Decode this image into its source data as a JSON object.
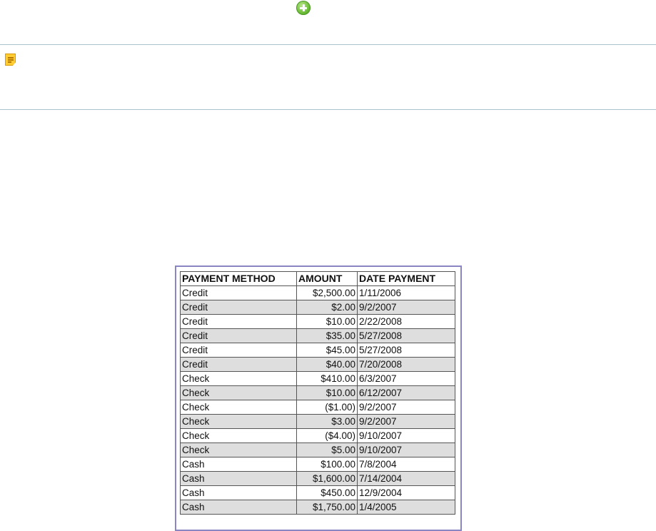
{
  "table": {
    "headers": [
      "PAYMENT METHOD",
      "AMOUNT",
      "DATE PAYMENT"
    ],
    "rows": [
      {
        "method": "Credit",
        "amount": "$2,500.00",
        "date": "1/11/2006"
      },
      {
        "method": "Credit",
        "amount": "$2.00",
        "date": "9/2/2007"
      },
      {
        "method": "Credit",
        "amount": "$10.00",
        "date": "2/22/2008"
      },
      {
        "method": "Credit",
        "amount": "$35.00",
        "date": "5/27/2008"
      },
      {
        "method": "Credit",
        "amount": "$45.00",
        "date": "5/27/2008"
      },
      {
        "method": "Credit",
        "amount": "$40.00",
        "date": "7/20/2008"
      },
      {
        "method": "Check",
        "amount": "$410.00",
        "date": "6/3/2007"
      },
      {
        "method": "Check",
        "amount": "$10.00",
        "date": "6/12/2007"
      },
      {
        "method": "Check",
        "amount": "($1.00)",
        "date": "9/2/2007"
      },
      {
        "method": "Check",
        "amount": "$3.00",
        "date": "9/2/2007"
      },
      {
        "method": "Check",
        "amount": "($4.00)",
        "date": "9/10/2007"
      },
      {
        "method": "Check",
        "amount": "$5.00",
        "date": "9/10/2007"
      },
      {
        "method": "Cash",
        "amount": "$100.00",
        "date": "7/8/2004"
      },
      {
        "method": "Cash",
        "amount": "$1,600.00",
        "date": "7/14/2004"
      },
      {
        "method": "Cash",
        "amount": "$450.00",
        "date": "12/9/2004"
      },
      {
        "method": "Cash",
        "amount": "$1,750.00",
        "date": "1/4/2005"
      }
    ]
  },
  "icons": {
    "add": "add-circle-icon",
    "note": "note-icon"
  },
  "colors": {
    "add_icon": "#6fbf3a",
    "note_icon": "#ffcc33",
    "divider": "#a9c3cf",
    "table_frame": "#8a86c4",
    "alt_row": "#dedede"
  }
}
